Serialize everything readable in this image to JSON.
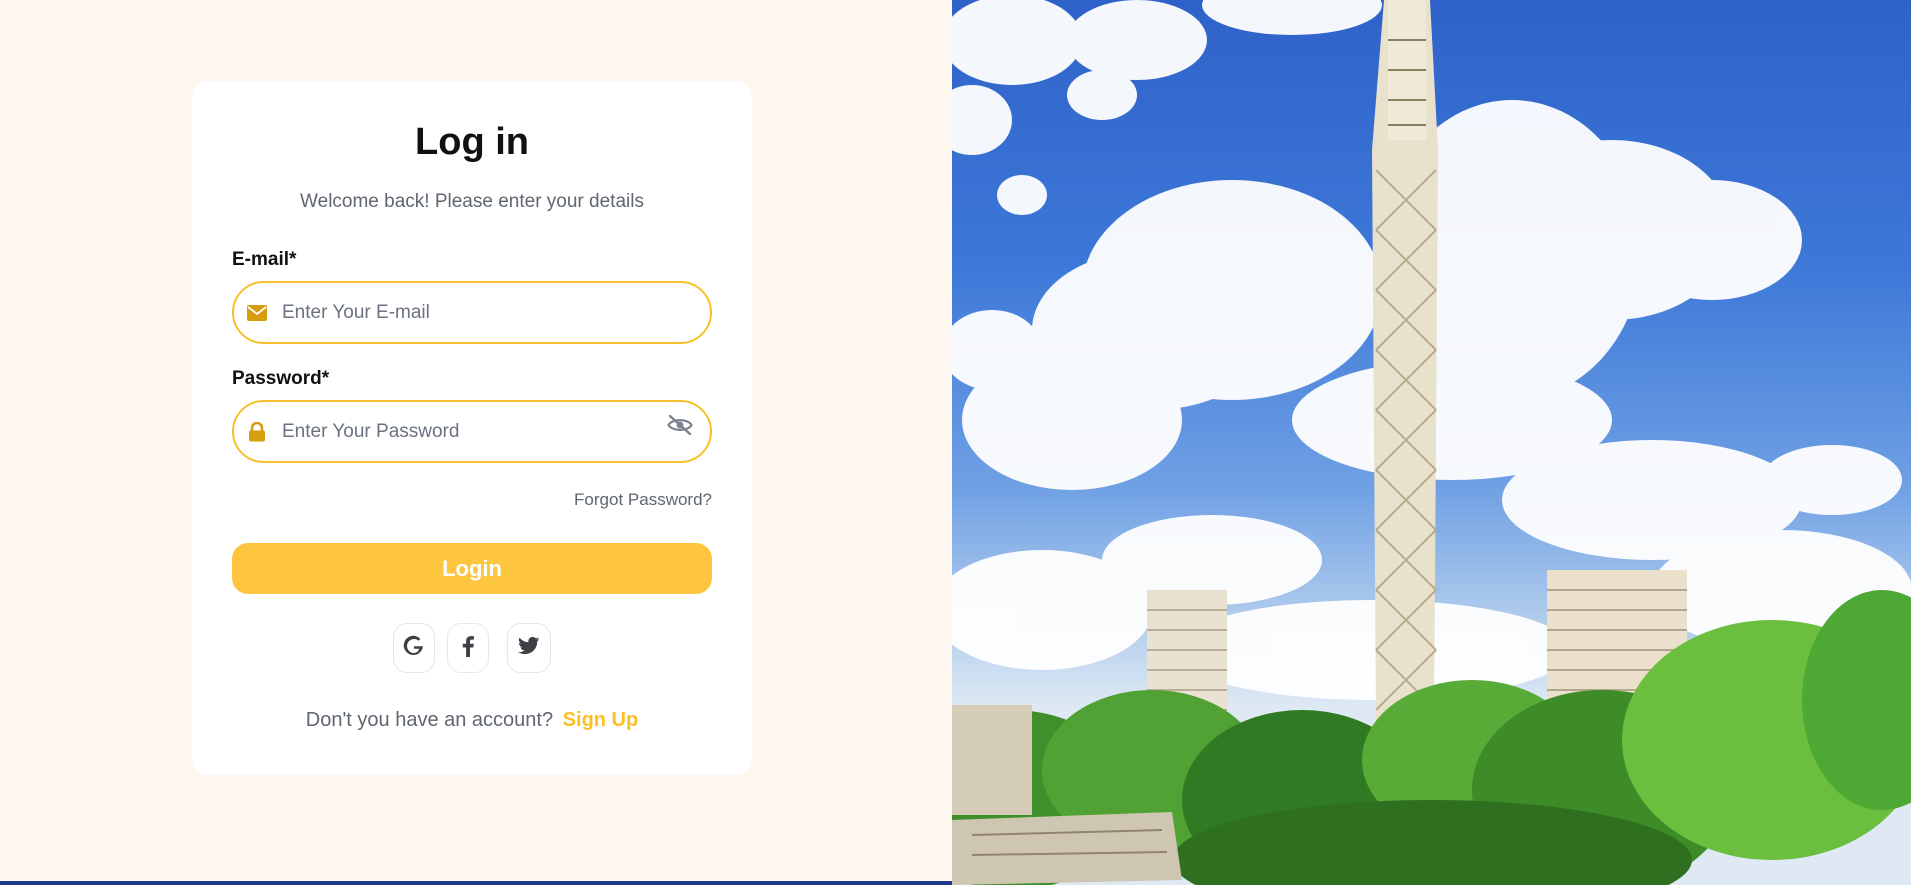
{
  "login": {
    "title": "Log in",
    "subtitle": "Welcome back! Please enter your details",
    "email_label": "E-mail*",
    "email_placeholder": "Enter Your E-mail",
    "email_value": "",
    "password_label": "Password*",
    "password_placeholder": "Enter Your Password",
    "password_value": "",
    "forgot_link": "Forgot Password?",
    "login_button": "Login",
    "social": [
      {
        "name": "google-icon",
        "glyph": "G"
      },
      {
        "name": "facebook-icon",
        "glyph": "f"
      },
      {
        "name": "twitter-icon",
        "glyph": "twitter-bird"
      }
    ],
    "signup_prompt": "Don't you have an account?",
    "signup_link": "Sign Up"
  },
  "colors": {
    "page_bg": "#fdf7f0",
    "card_bg": "#ffffff",
    "accent": "#fec53f",
    "field_border": "#f5c02a",
    "icon_gold": "#d69e0d",
    "link_yellow": "#fbbf24"
  },
  "hero": {
    "image": "cairo-tower-photo"
  }
}
